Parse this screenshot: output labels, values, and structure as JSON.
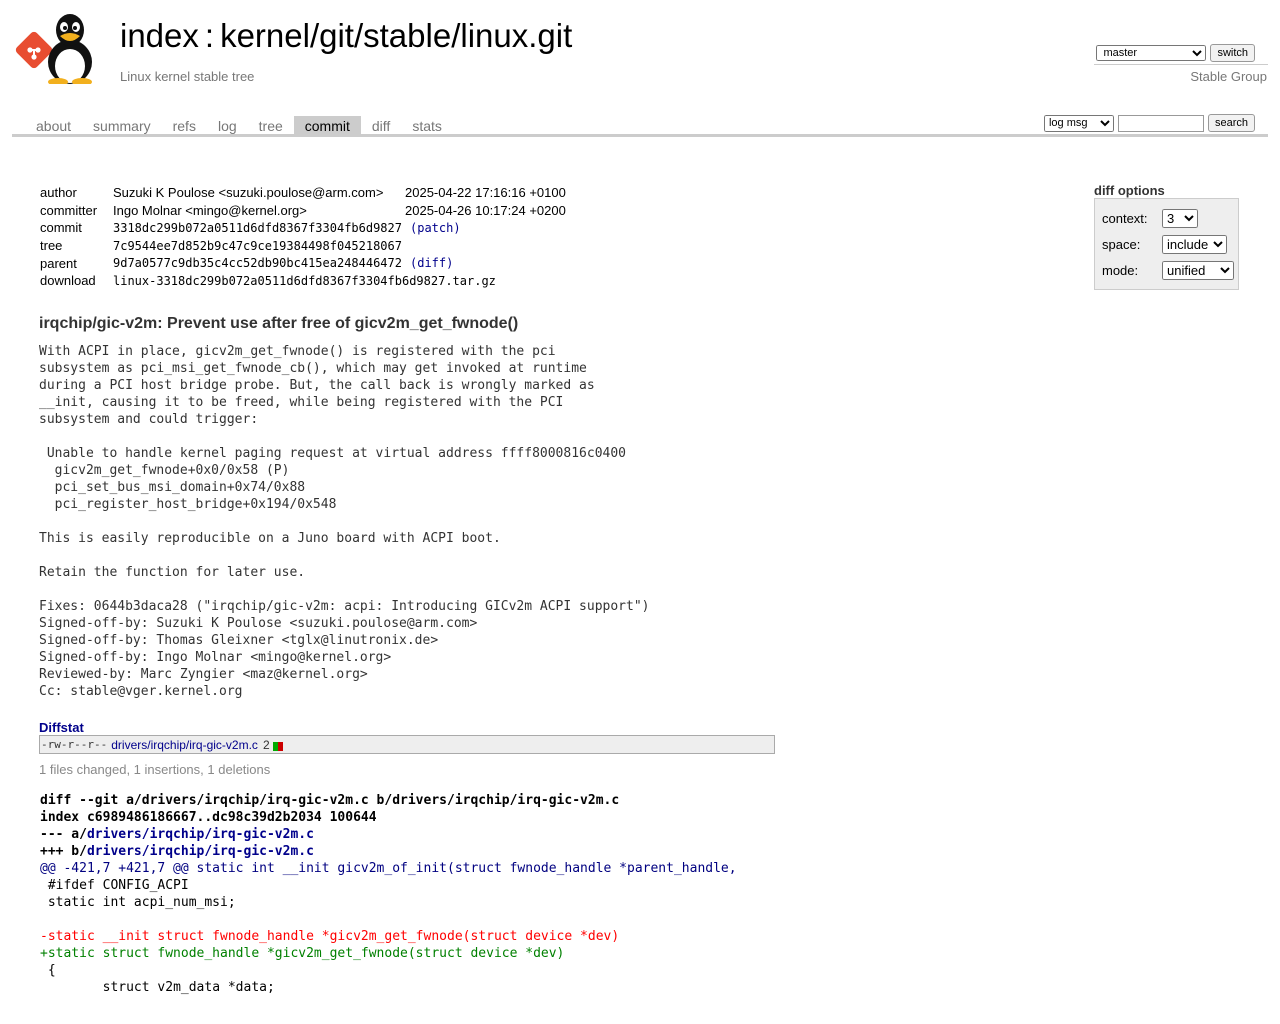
{
  "header": {
    "repo_index": "index",
    "separator": ":",
    "repo_path": "kernel/git/stable/linux.git",
    "description": "Linux kernel stable tree",
    "owner": "Stable Group",
    "branch_selected": "master",
    "switch_label": "switch"
  },
  "tabs": [
    {
      "label": "about",
      "active": false
    },
    {
      "label": "summary",
      "active": false
    },
    {
      "label": "refs",
      "active": false
    },
    {
      "label": "log",
      "active": false
    },
    {
      "label": "tree",
      "active": false
    },
    {
      "label": "commit",
      "active": true
    },
    {
      "label": "diff",
      "active": false
    },
    {
      "label": "stats",
      "active": false
    }
  ],
  "search": {
    "scope_selected": "log msg",
    "query": "",
    "button_label": "search"
  },
  "diff_options": {
    "title": "diff options",
    "context_label": "context:",
    "context_value": "3",
    "space_label": "space:",
    "space_value": "include",
    "mode_label": "mode:",
    "mode_value": "unified"
  },
  "commit": {
    "author_key": "author",
    "author": "Suzuki K Poulose <suzuki.poulose@arm.com>",
    "author_date": "2025-04-22 17:16:16 +0100",
    "committer_key": "committer",
    "committer": "Ingo Molnar <mingo@kernel.org>",
    "committer_date": "2025-04-26 10:17:24 +0200",
    "commit_key": "commit",
    "commit_hash": "3318dc299b072a0511d6dfd8367f3304fb6d9827",
    "commit_paren_open": "(",
    "commit_link": "patch",
    "commit_paren_close": ")",
    "tree_key": "tree",
    "tree_hash": "7c9544ee7d852b9c47c9ce19384498f045218067",
    "parent_key": "parent",
    "parent_hash": "9d7a0577c9db35c4cc52db90bc415ea248446472",
    "parent_paren_open": "(",
    "parent_link": "diff",
    "parent_paren_close": ")",
    "download_key": "download",
    "download_file": "linux-3318dc299b072a0511d6dfd8367f3304fb6d9827.tar.gz",
    "subject": "irqchip/gic-v2m: Prevent use after free of gicv2m_get_fwnode()",
    "message": "With ACPI in place, gicv2m_get_fwnode() is registered with the pci\nsubsystem as pci_msi_get_fwnode_cb(), which may get invoked at runtime\nduring a PCI host bridge probe. But, the call back is wrongly marked as\n__init, causing it to be freed, while being registered with the PCI\nsubsystem and could trigger:\n\n Unable to handle kernel paging request at virtual address ffff8000816c0400\n  gicv2m_get_fwnode+0x0/0x58 (P)\n  pci_set_bus_msi_domain+0x74/0x88\n  pci_register_host_bridge+0x194/0x548\n\nThis is easily reproducible on a Juno board with ACPI boot.\n\nRetain the function for later use.\n\nFixes: 0644b3daca28 (\"irqchip/gic-v2m: acpi: Introducing GICv2m ACPI support\")\nSigned-off-by: Suzuki K Poulose <suzuki.poulose@arm.com>\nSigned-off-by: Thomas Gleixner <tglx@linutronix.de>\nSigned-off-by: Ingo Molnar <mingo@kernel.org>\nReviewed-by: Marc Zyngier <maz@kernel.org>\nCc: stable@vger.kernel.org"
  },
  "diffstat": {
    "title": "Diffstat",
    "mode": "-rw-r--r--",
    "file": "drivers/irqchip/irq-gic-v2m.c",
    "changes": "2",
    "insertions": 1,
    "deletions": 1,
    "summary": "1 files changed, 1 insertions, 1 deletions",
    "add_color": "#00aa00",
    "del_color": "#cc0000"
  },
  "diff": {
    "line1": "diff --git a/drivers/irqchip/irq-gic-v2m.c b/drivers/irqchip/irq-gic-v2m.c",
    "line2": "index c6989486186667..dc98c39d2b2034 100644",
    "minus_prefix": "--- a/",
    "minus_file": "drivers/irqchip/irq-gic-v2m.c",
    "plus_prefix": "+++ b/",
    "plus_file": "drivers/irqchip/irq-gic-v2m.c",
    "hunk": "@@ -421,7 +421,7 @@ static int __init gicv2m_of_init(struct fwnode_handle *parent_handle,",
    "ctx1": " #ifdef CONFIG_ACPI",
    "ctx2": " static int acpi_num_msi;",
    "ctx3": " ",
    "del1": "-static __init struct fwnode_handle *gicv2m_get_fwnode(struct device *dev)",
    "add1": "+static struct fwnode_handle *gicv2m_get_fwnode(struct device *dev)",
    "ctx4": " {",
    "ctx5": " \tstruct v2m_data *data;"
  }
}
